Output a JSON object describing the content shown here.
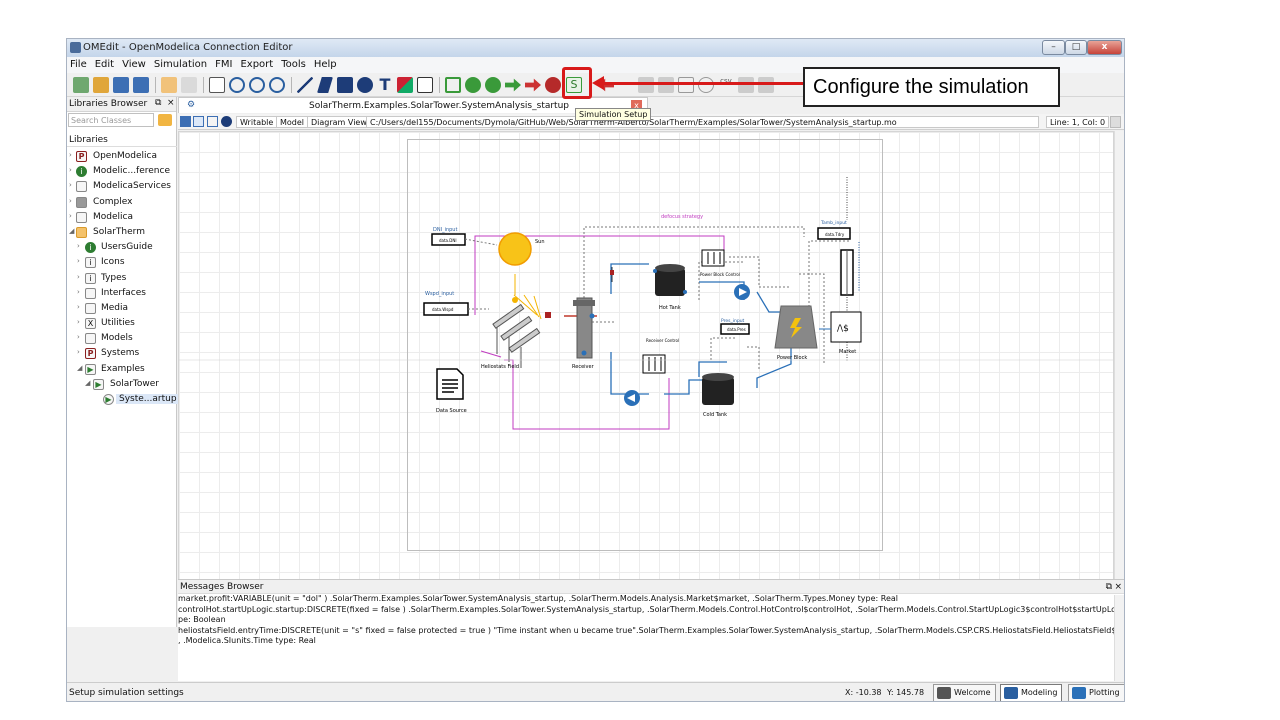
{
  "window": {
    "title": "OMEdit - OpenModelica Connection Editor"
  },
  "menu": [
    "File",
    "Edit",
    "View",
    "Simulation",
    "FMI",
    "Export",
    "Tools",
    "Help"
  ],
  "toolbar": {
    "csv_label": "csv",
    "sim_setup_glyph": "S"
  },
  "tooltip": "Simulation Setup",
  "callout": "Configure the simulation",
  "libraries": {
    "header": "Libraries Browser",
    "search_placeholder": "Search Classes",
    "title": "Libraries",
    "items": [
      {
        "label": "OpenModelica",
        "icon": "P"
      },
      {
        "label": "Modelic...ference",
        "icon": "i"
      },
      {
        "label": "ModelicaServices",
        "icon": ""
      },
      {
        "label": "Complex",
        "icon": ""
      },
      {
        "label": "Modelica",
        "icon": ""
      },
      {
        "label": "SolarTherm",
        "icon": ""
      },
      {
        "label": "UsersGuide",
        "icon": "i"
      },
      {
        "label": "Icons",
        "icon": "i"
      },
      {
        "label": "Types",
        "icon": "i"
      },
      {
        "label": "Interfaces",
        "icon": ""
      },
      {
        "label": "Media",
        "icon": ""
      },
      {
        "label": "Utilities",
        "icon": "X"
      },
      {
        "label": "Models",
        "icon": ""
      },
      {
        "label": "Systems",
        "icon": "P"
      },
      {
        "label": "Examples",
        "icon": "▶"
      },
      {
        "label": "SolarTower",
        "icon": "▶"
      },
      {
        "label": "Syste...artup",
        "icon": "▶"
      }
    ]
  },
  "tab": {
    "title": "SolarTherm.Examples.SolarTower.SystemAnalysis_startup",
    "close": "x"
  },
  "modelbar": {
    "writable": "Writable",
    "model": "Model",
    "diagram": "Diagram View",
    "path": "C:/Users/del155/Documents/Dymola/GitHub/Web/SolarTherm-Alberto/SolarTherm/Examples/SolarTower/SystemAnalysis_startup.mo",
    "linecol": "Line: 1, Col: 0"
  },
  "diagram": {
    "defocus": "defocus strategy",
    "sun": "Sun",
    "dni_input": "DNI_input",
    "dni_box": "data.DNI",
    "wspd_input": "Wspd_input",
    "wspd_box": "data.Wspd",
    "heliostats": "Heliostats Field",
    "receiver": "Receiver",
    "hot_tank": "Hot Tank",
    "cold_tank": "Cold Tank",
    "pb_control": "Power Block Control",
    "rcv_control": "Receiver Control",
    "pres_input": "Pres_input",
    "pres_box": "data.Pres",
    "power_block": "Power Block",
    "tamb_input": "Tamb_input",
    "tamb_box": "data.Tdry",
    "market": "Market",
    "data_source": "Data Source"
  },
  "messages": {
    "header": "Messages Browser",
    "lines": [
      "        market.profit:VARIABLE(unit = \"dol\" ) .SolarTherm.Examples.SolarTower.SystemAnalysis_startup, .SolarTherm.Models.Analysis.Market$market, .SolarTherm.Types.Money type: Real",
      "        controlHot.startUpLogic.startup:DISCRETE(fixed = false ) .SolarTherm.Examples.SolarTower.SystemAnalysis_startup, .SolarTherm.Models.Control.HotControl$controlHot, .SolarTherm.Models.Control.StartUpLogic3$controlHot$startUpLogic, .Boolean ty",
      "pe: Boolean",
      "        heliostatsField.entryTime:DISCRETE(unit = \"s\" fixed = false protected = true )  \"Time instant when u became true\".SolarTherm.Examples.SolarTower.SystemAnalysis_startup, .SolarTherm.Models.CSP.CRS.HeliostatsField.HeliostatsField$heliostatsField",
      ", .Modelica.SIunits.Time type: Real"
    ]
  },
  "status": {
    "text": "Setup simulation settings",
    "x": "X: -10.38",
    "y": "Y: 145.78",
    "welcome": "Welcome",
    "modeling": "Modeling",
    "plotting": "Plotting"
  }
}
